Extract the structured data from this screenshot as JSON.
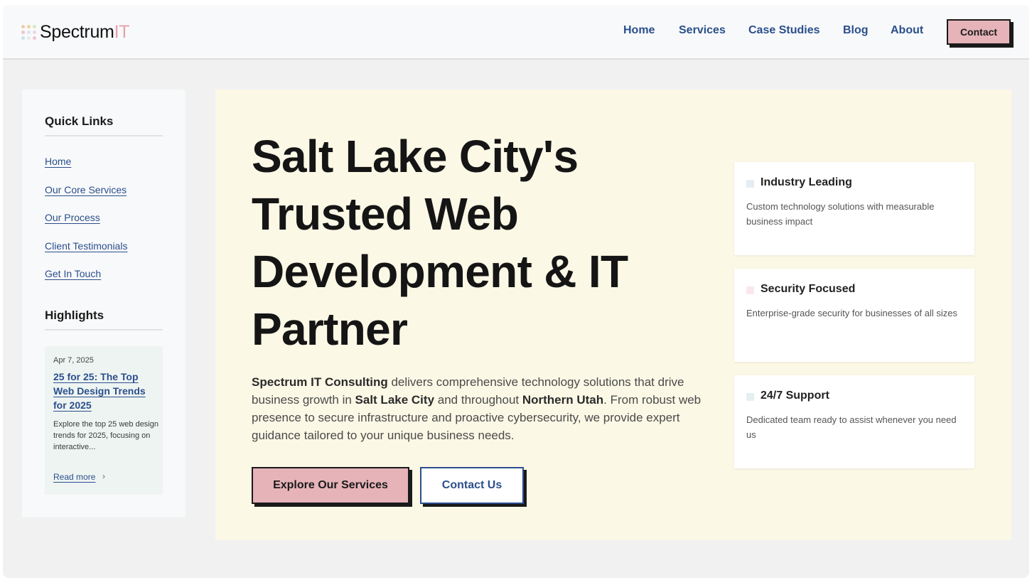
{
  "header": {
    "logo": {
      "text": "Spectrum",
      "accent": "IT",
      "dot_colors": [
        "#f4c9a8",
        "#e9d7a0",
        "#d8e7c4",
        "#f2c4cd",
        "#d9e6f1",
        "#ecd7e3",
        "#cde0ef",
        "#e8e8e8",
        "#f0c4d3"
      ]
    },
    "nav": [
      "Home",
      "Services",
      "Case Studies",
      "Blog",
      "About"
    ],
    "contact_label": "Contact"
  },
  "sidebar": {
    "quick_links_heading": "Quick Links",
    "links": [
      "Home",
      "Our Core Services",
      "Our Process",
      "Client Testimonials",
      "Get In Touch"
    ],
    "highlights_heading": "Highlights",
    "post": {
      "date": "Apr 7, 2025",
      "title": "25 for 25: The Top Web Design Trends for 2025",
      "excerpt": "Explore the top 25 web design trends for 2025, focusing on interactive...",
      "read_more": "Read more",
      "chevron": "›"
    }
  },
  "hero": {
    "title": "Salt Lake City's Trusted Web Development & IT Partner",
    "description": {
      "company": "Spectrum IT Consulting",
      "part1": " delivers comprehensive technology solutions that drive business growth in ",
      "city": "Salt Lake City",
      "part2": " and throughout ",
      "region": "Northern Utah",
      "part3": ". From robust web presence to secure infrastructure and proactive cybersecurity, we provide expert guidance tailored to your unique business needs."
    },
    "primary_button": "Explore Our Services",
    "secondary_button": "Contact Us"
  },
  "features": [
    {
      "title": "Industry Leading",
      "description": "Custom technology solutions with measurable business impact",
      "icon_color": "#e3eef4"
    },
    {
      "title": "Security Focused",
      "description": "Enterprise-grade security for businesses of all sizes",
      "icon_color": "#f8e8ec"
    },
    {
      "title": "24/7 Support",
      "description": "Dedicated team ready to assist whenever you need us",
      "icon_color": "#e4f0ef"
    }
  ],
  "colors": {
    "link_blue": "#2b4f8c",
    "accent_pink": "#e6b3b9",
    "hero_background": "#fcf8e6",
    "page_background": "#f1f1f1"
  }
}
